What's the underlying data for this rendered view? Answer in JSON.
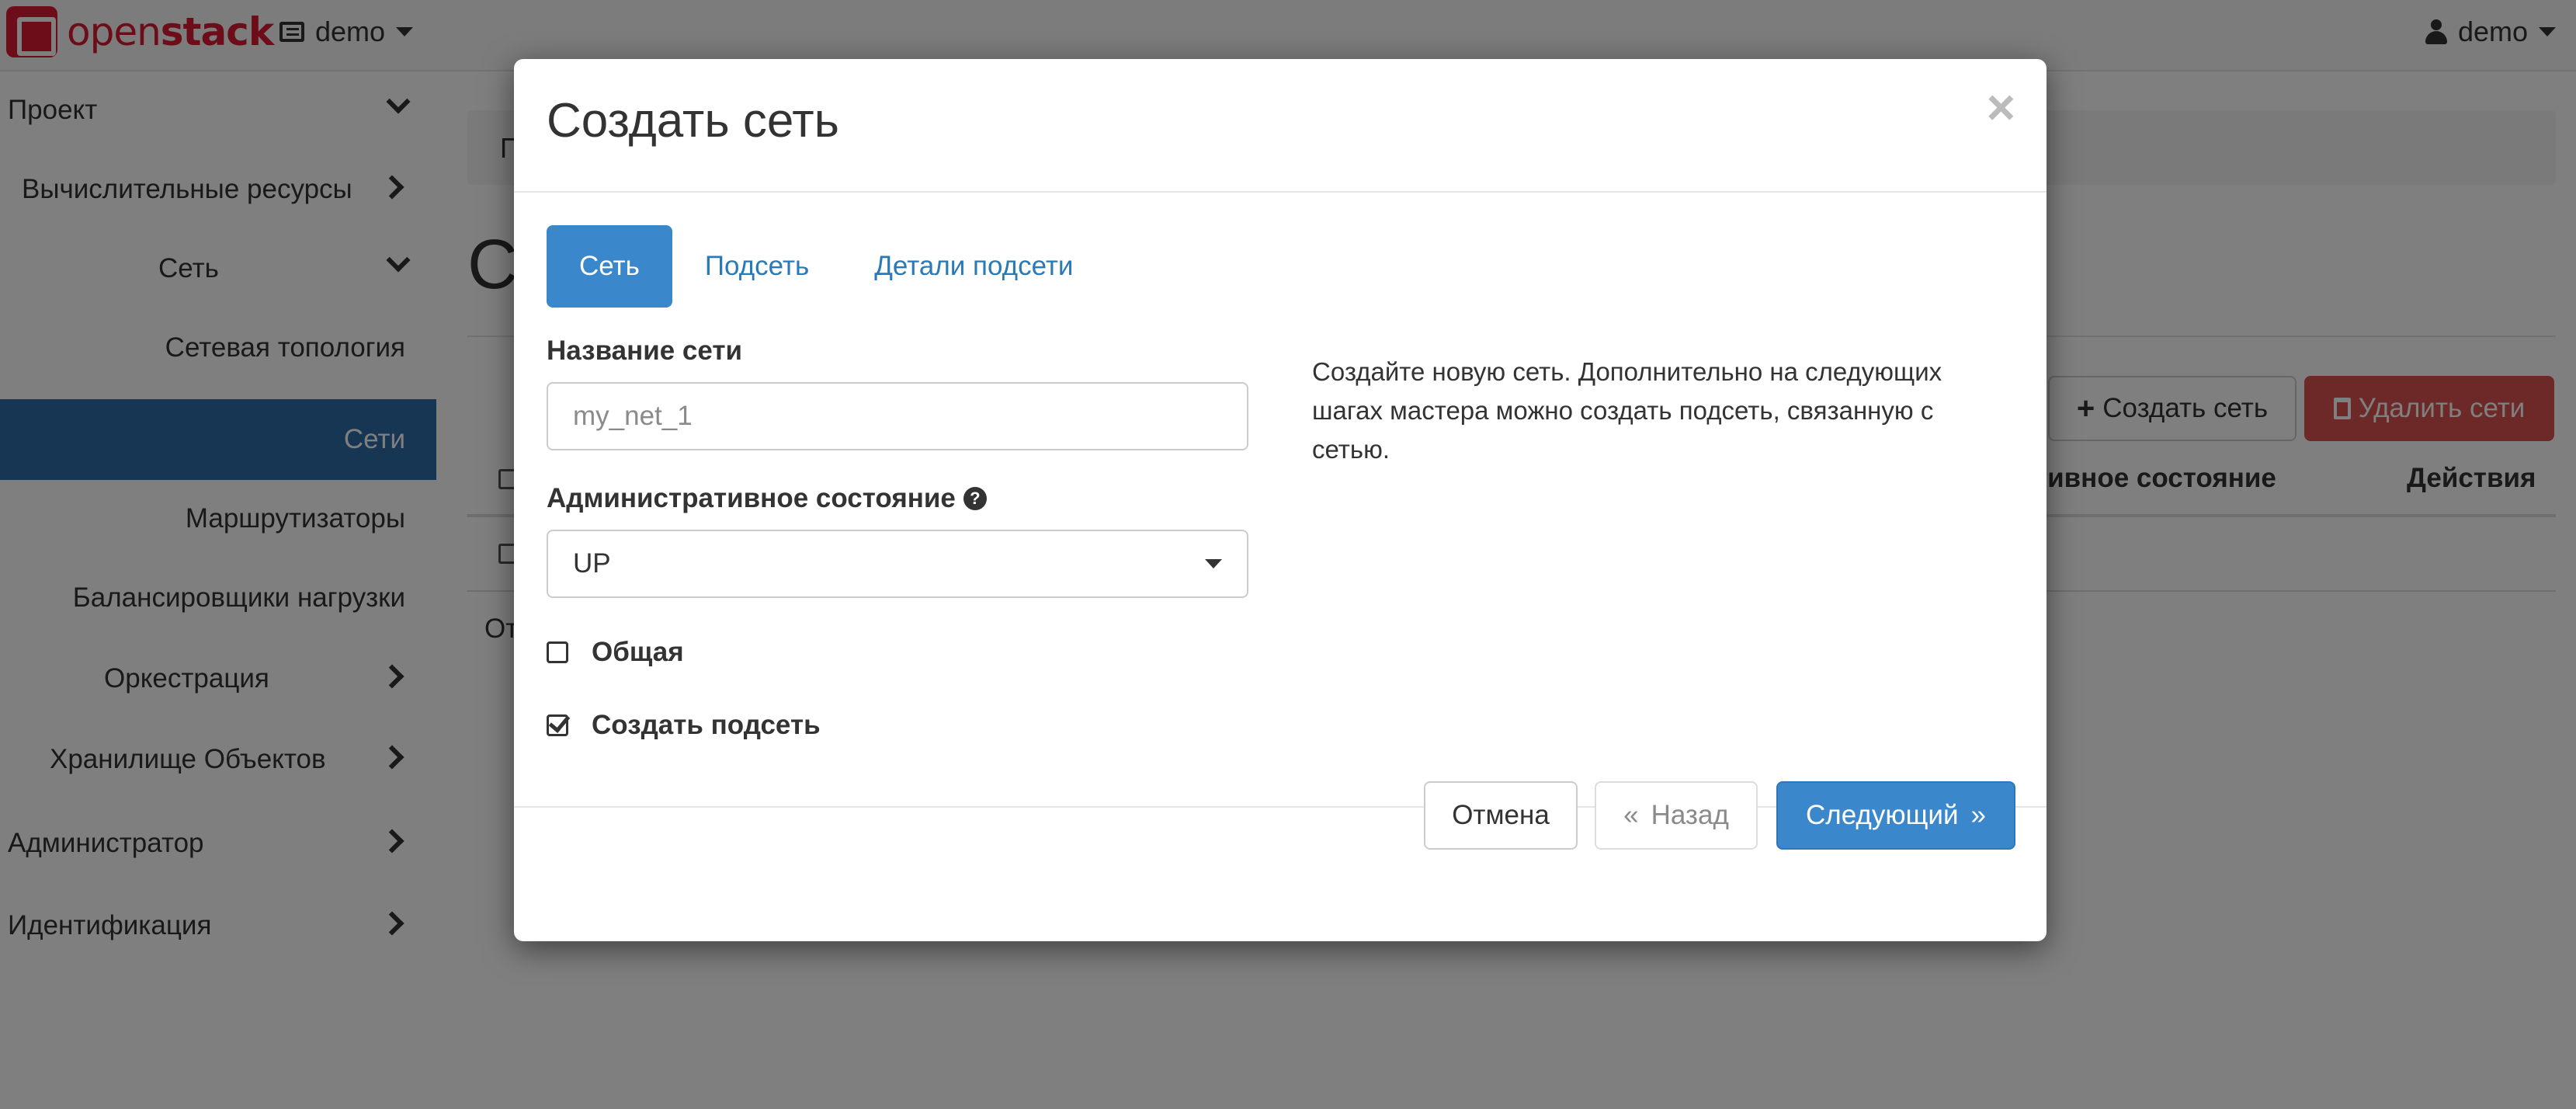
{
  "navbar": {
    "brand_open": "open",
    "brand_stack": "stack",
    "project": "demo",
    "user": "demo"
  },
  "sidebar": {
    "items": [
      {
        "label": "Проект",
        "state": "expanded"
      },
      {
        "label": "Вычислительные ресурсы",
        "state": "collapsed"
      },
      {
        "label": "Сеть",
        "state": "expanded"
      },
      {
        "label": "Сетевая топология"
      },
      {
        "label": "Сети",
        "active": true
      },
      {
        "label": "Маршрутизаторы"
      },
      {
        "label": "Балансировщики нагрузки"
      },
      {
        "label": "Оркестрация",
        "state": "collapsed"
      },
      {
        "label": "Хранилище Объектов",
        "state": "collapsed"
      },
      {
        "label": "Администратор",
        "state": "collapsed"
      },
      {
        "label": "Идентификация",
        "state": "collapsed"
      }
    ]
  },
  "background": {
    "breadcrumb": "П",
    "page_heading": "С",
    "create_button": "Создать сеть",
    "delete_button": "Удалить сети",
    "col_admin_state": "тивное состояние",
    "col_actions": "Действия",
    "footer_text": "От"
  },
  "modal": {
    "title": "Создать сеть",
    "close": "×",
    "tabs": [
      {
        "label": "Сеть",
        "active": true
      },
      {
        "label": "Подсеть"
      },
      {
        "label": "Детали подсети"
      }
    ],
    "network_name_label": "Название сети",
    "network_name_placeholder": "my_net_1",
    "admin_state_label": "Административное состояние",
    "admin_state_value": "UP",
    "shared_label": "Общая",
    "shared_checked": false,
    "create_subnet_label": "Создать подсеть",
    "create_subnet_checked": true,
    "help_text": "Создайте новую сеть. Дополнительно на следующих шагах мастера можно создать подсеть, связанную с сетью.",
    "buttons": {
      "cancel": "Отмена",
      "back": "Назад",
      "back_prefix": "«",
      "next": "Следующий",
      "next_suffix": "»"
    }
  },
  "colors": {
    "primary": "#3a87cc",
    "sidebar_active": "#2c6da9",
    "danger": "#d9534f",
    "brand": "#da1a32"
  }
}
